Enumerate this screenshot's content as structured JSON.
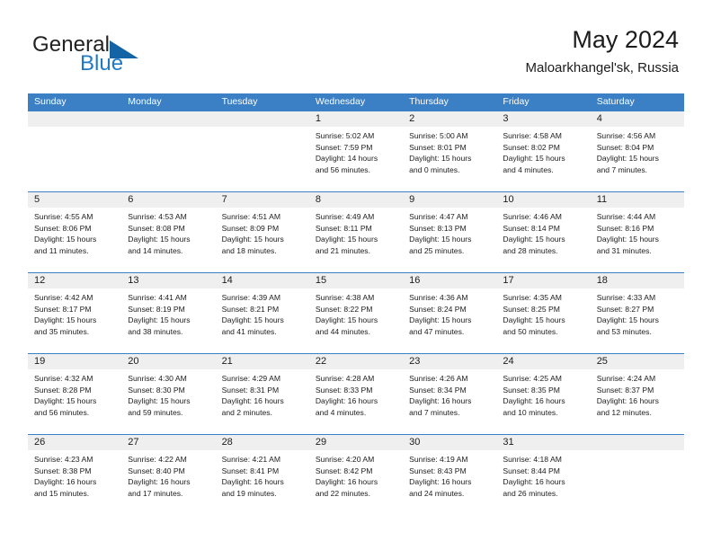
{
  "brand": {
    "name_part1": "General",
    "name_part2": "Blue",
    "triangle_color": "#1464a5",
    "blue_color": "#1f7ac6"
  },
  "header": {
    "title": "May 2024",
    "subtitle": "Maloarkhangel'sk, Russia"
  },
  "theme": {
    "header_row_bg": "#3b7fc4",
    "daynum_band_bg": "#efefef",
    "page_bg": "#ffffff",
    "text_color": "#1c1c1c"
  },
  "weekdays": [
    "Sunday",
    "Monday",
    "Tuesday",
    "Wednesday",
    "Thursday",
    "Friday",
    "Saturday"
  ],
  "labels": {
    "sunrise_prefix": "Sunrise:",
    "sunset_prefix": "Sunset:",
    "daylight_prefix": "Daylight:"
  },
  "weeks": [
    [
      {
        "day": "",
        "empty": true,
        "line1": "",
        "line2": "",
        "line3": "",
        "line4": ""
      },
      {
        "day": "",
        "empty": true,
        "line1": "",
        "line2": "",
        "line3": "",
        "line4": ""
      },
      {
        "day": "",
        "empty": true,
        "line1": "",
        "line2": "",
        "line3": "",
        "line4": ""
      },
      {
        "day": "1",
        "empty": false,
        "line1": "Sunrise: 5:02 AM",
        "line2": "Sunset: 7:59 PM",
        "line3": "Daylight: 14 hours",
        "line4": "and 56 minutes."
      },
      {
        "day": "2",
        "empty": false,
        "line1": "Sunrise: 5:00 AM",
        "line2": "Sunset: 8:01 PM",
        "line3": "Daylight: 15 hours",
        "line4": "and 0 minutes."
      },
      {
        "day": "3",
        "empty": false,
        "line1": "Sunrise: 4:58 AM",
        "line2": "Sunset: 8:02 PM",
        "line3": "Daylight: 15 hours",
        "line4": "and 4 minutes."
      },
      {
        "day": "4",
        "empty": false,
        "line1": "Sunrise: 4:56 AM",
        "line2": "Sunset: 8:04 PM",
        "line3": "Daylight: 15 hours",
        "line4": "and 7 minutes."
      }
    ],
    [
      {
        "day": "5",
        "empty": false,
        "line1": "Sunrise: 4:55 AM",
        "line2": "Sunset: 8:06 PM",
        "line3": "Daylight: 15 hours",
        "line4": "and 11 minutes."
      },
      {
        "day": "6",
        "empty": false,
        "line1": "Sunrise: 4:53 AM",
        "line2": "Sunset: 8:08 PM",
        "line3": "Daylight: 15 hours",
        "line4": "and 14 minutes."
      },
      {
        "day": "7",
        "empty": false,
        "line1": "Sunrise: 4:51 AM",
        "line2": "Sunset: 8:09 PM",
        "line3": "Daylight: 15 hours",
        "line4": "and 18 minutes."
      },
      {
        "day": "8",
        "empty": false,
        "line1": "Sunrise: 4:49 AM",
        "line2": "Sunset: 8:11 PM",
        "line3": "Daylight: 15 hours",
        "line4": "and 21 minutes."
      },
      {
        "day": "9",
        "empty": false,
        "line1": "Sunrise: 4:47 AM",
        "line2": "Sunset: 8:13 PM",
        "line3": "Daylight: 15 hours",
        "line4": "and 25 minutes."
      },
      {
        "day": "10",
        "empty": false,
        "line1": "Sunrise: 4:46 AM",
        "line2": "Sunset: 8:14 PM",
        "line3": "Daylight: 15 hours",
        "line4": "and 28 minutes."
      },
      {
        "day": "11",
        "empty": false,
        "line1": "Sunrise: 4:44 AM",
        "line2": "Sunset: 8:16 PM",
        "line3": "Daylight: 15 hours",
        "line4": "and 31 minutes."
      }
    ],
    [
      {
        "day": "12",
        "empty": false,
        "line1": "Sunrise: 4:42 AM",
        "line2": "Sunset: 8:17 PM",
        "line3": "Daylight: 15 hours",
        "line4": "and 35 minutes."
      },
      {
        "day": "13",
        "empty": false,
        "line1": "Sunrise: 4:41 AM",
        "line2": "Sunset: 8:19 PM",
        "line3": "Daylight: 15 hours",
        "line4": "and 38 minutes."
      },
      {
        "day": "14",
        "empty": false,
        "line1": "Sunrise: 4:39 AM",
        "line2": "Sunset: 8:21 PM",
        "line3": "Daylight: 15 hours",
        "line4": "and 41 minutes."
      },
      {
        "day": "15",
        "empty": false,
        "line1": "Sunrise: 4:38 AM",
        "line2": "Sunset: 8:22 PM",
        "line3": "Daylight: 15 hours",
        "line4": "and 44 minutes."
      },
      {
        "day": "16",
        "empty": false,
        "line1": "Sunrise: 4:36 AM",
        "line2": "Sunset: 8:24 PM",
        "line3": "Daylight: 15 hours",
        "line4": "and 47 minutes."
      },
      {
        "day": "17",
        "empty": false,
        "line1": "Sunrise: 4:35 AM",
        "line2": "Sunset: 8:25 PM",
        "line3": "Daylight: 15 hours",
        "line4": "and 50 minutes."
      },
      {
        "day": "18",
        "empty": false,
        "line1": "Sunrise: 4:33 AM",
        "line2": "Sunset: 8:27 PM",
        "line3": "Daylight: 15 hours",
        "line4": "and 53 minutes."
      }
    ],
    [
      {
        "day": "19",
        "empty": false,
        "line1": "Sunrise: 4:32 AM",
        "line2": "Sunset: 8:28 PM",
        "line3": "Daylight: 15 hours",
        "line4": "and 56 minutes."
      },
      {
        "day": "20",
        "empty": false,
        "line1": "Sunrise: 4:30 AM",
        "line2": "Sunset: 8:30 PM",
        "line3": "Daylight: 15 hours",
        "line4": "and 59 minutes."
      },
      {
        "day": "21",
        "empty": false,
        "line1": "Sunrise: 4:29 AM",
        "line2": "Sunset: 8:31 PM",
        "line3": "Daylight: 16 hours",
        "line4": "and 2 minutes."
      },
      {
        "day": "22",
        "empty": false,
        "line1": "Sunrise: 4:28 AM",
        "line2": "Sunset: 8:33 PM",
        "line3": "Daylight: 16 hours",
        "line4": "and 4 minutes."
      },
      {
        "day": "23",
        "empty": false,
        "line1": "Sunrise: 4:26 AM",
        "line2": "Sunset: 8:34 PM",
        "line3": "Daylight: 16 hours",
        "line4": "and 7 minutes."
      },
      {
        "day": "24",
        "empty": false,
        "line1": "Sunrise: 4:25 AM",
        "line2": "Sunset: 8:35 PM",
        "line3": "Daylight: 16 hours",
        "line4": "and 10 minutes."
      },
      {
        "day": "25",
        "empty": false,
        "line1": "Sunrise: 4:24 AM",
        "line2": "Sunset: 8:37 PM",
        "line3": "Daylight: 16 hours",
        "line4": "and 12 minutes."
      }
    ],
    [
      {
        "day": "26",
        "empty": false,
        "line1": "Sunrise: 4:23 AM",
        "line2": "Sunset: 8:38 PM",
        "line3": "Daylight: 16 hours",
        "line4": "and 15 minutes."
      },
      {
        "day": "27",
        "empty": false,
        "line1": "Sunrise: 4:22 AM",
        "line2": "Sunset: 8:40 PM",
        "line3": "Daylight: 16 hours",
        "line4": "and 17 minutes."
      },
      {
        "day": "28",
        "empty": false,
        "line1": "Sunrise: 4:21 AM",
        "line2": "Sunset: 8:41 PM",
        "line3": "Daylight: 16 hours",
        "line4": "and 19 minutes."
      },
      {
        "day": "29",
        "empty": false,
        "line1": "Sunrise: 4:20 AM",
        "line2": "Sunset: 8:42 PM",
        "line3": "Daylight: 16 hours",
        "line4": "and 22 minutes."
      },
      {
        "day": "30",
        "empty": false,
        "line1": "Sunrise: 4:19 AM",
        "line2": "Sunset: 8:43 PM",
        "line3": "Daylight: 16 hours",
        "line4": "and 24 minutes."
      },
      {
        "day": "31",
        "empty": false,
        "line1": "Sunrise: 4:18 AM",
        "line2": "Sunset: 8:44 PM",
        "line3": "Daylight: 16 hours",
        "line4": "and 26 minutes."
      },
      {
        "day": "",
        "empty": true,
        "line1": "",
        "line2": "",
        "line3": "",
        "line4": ""
      }
    ]
  ]
}
